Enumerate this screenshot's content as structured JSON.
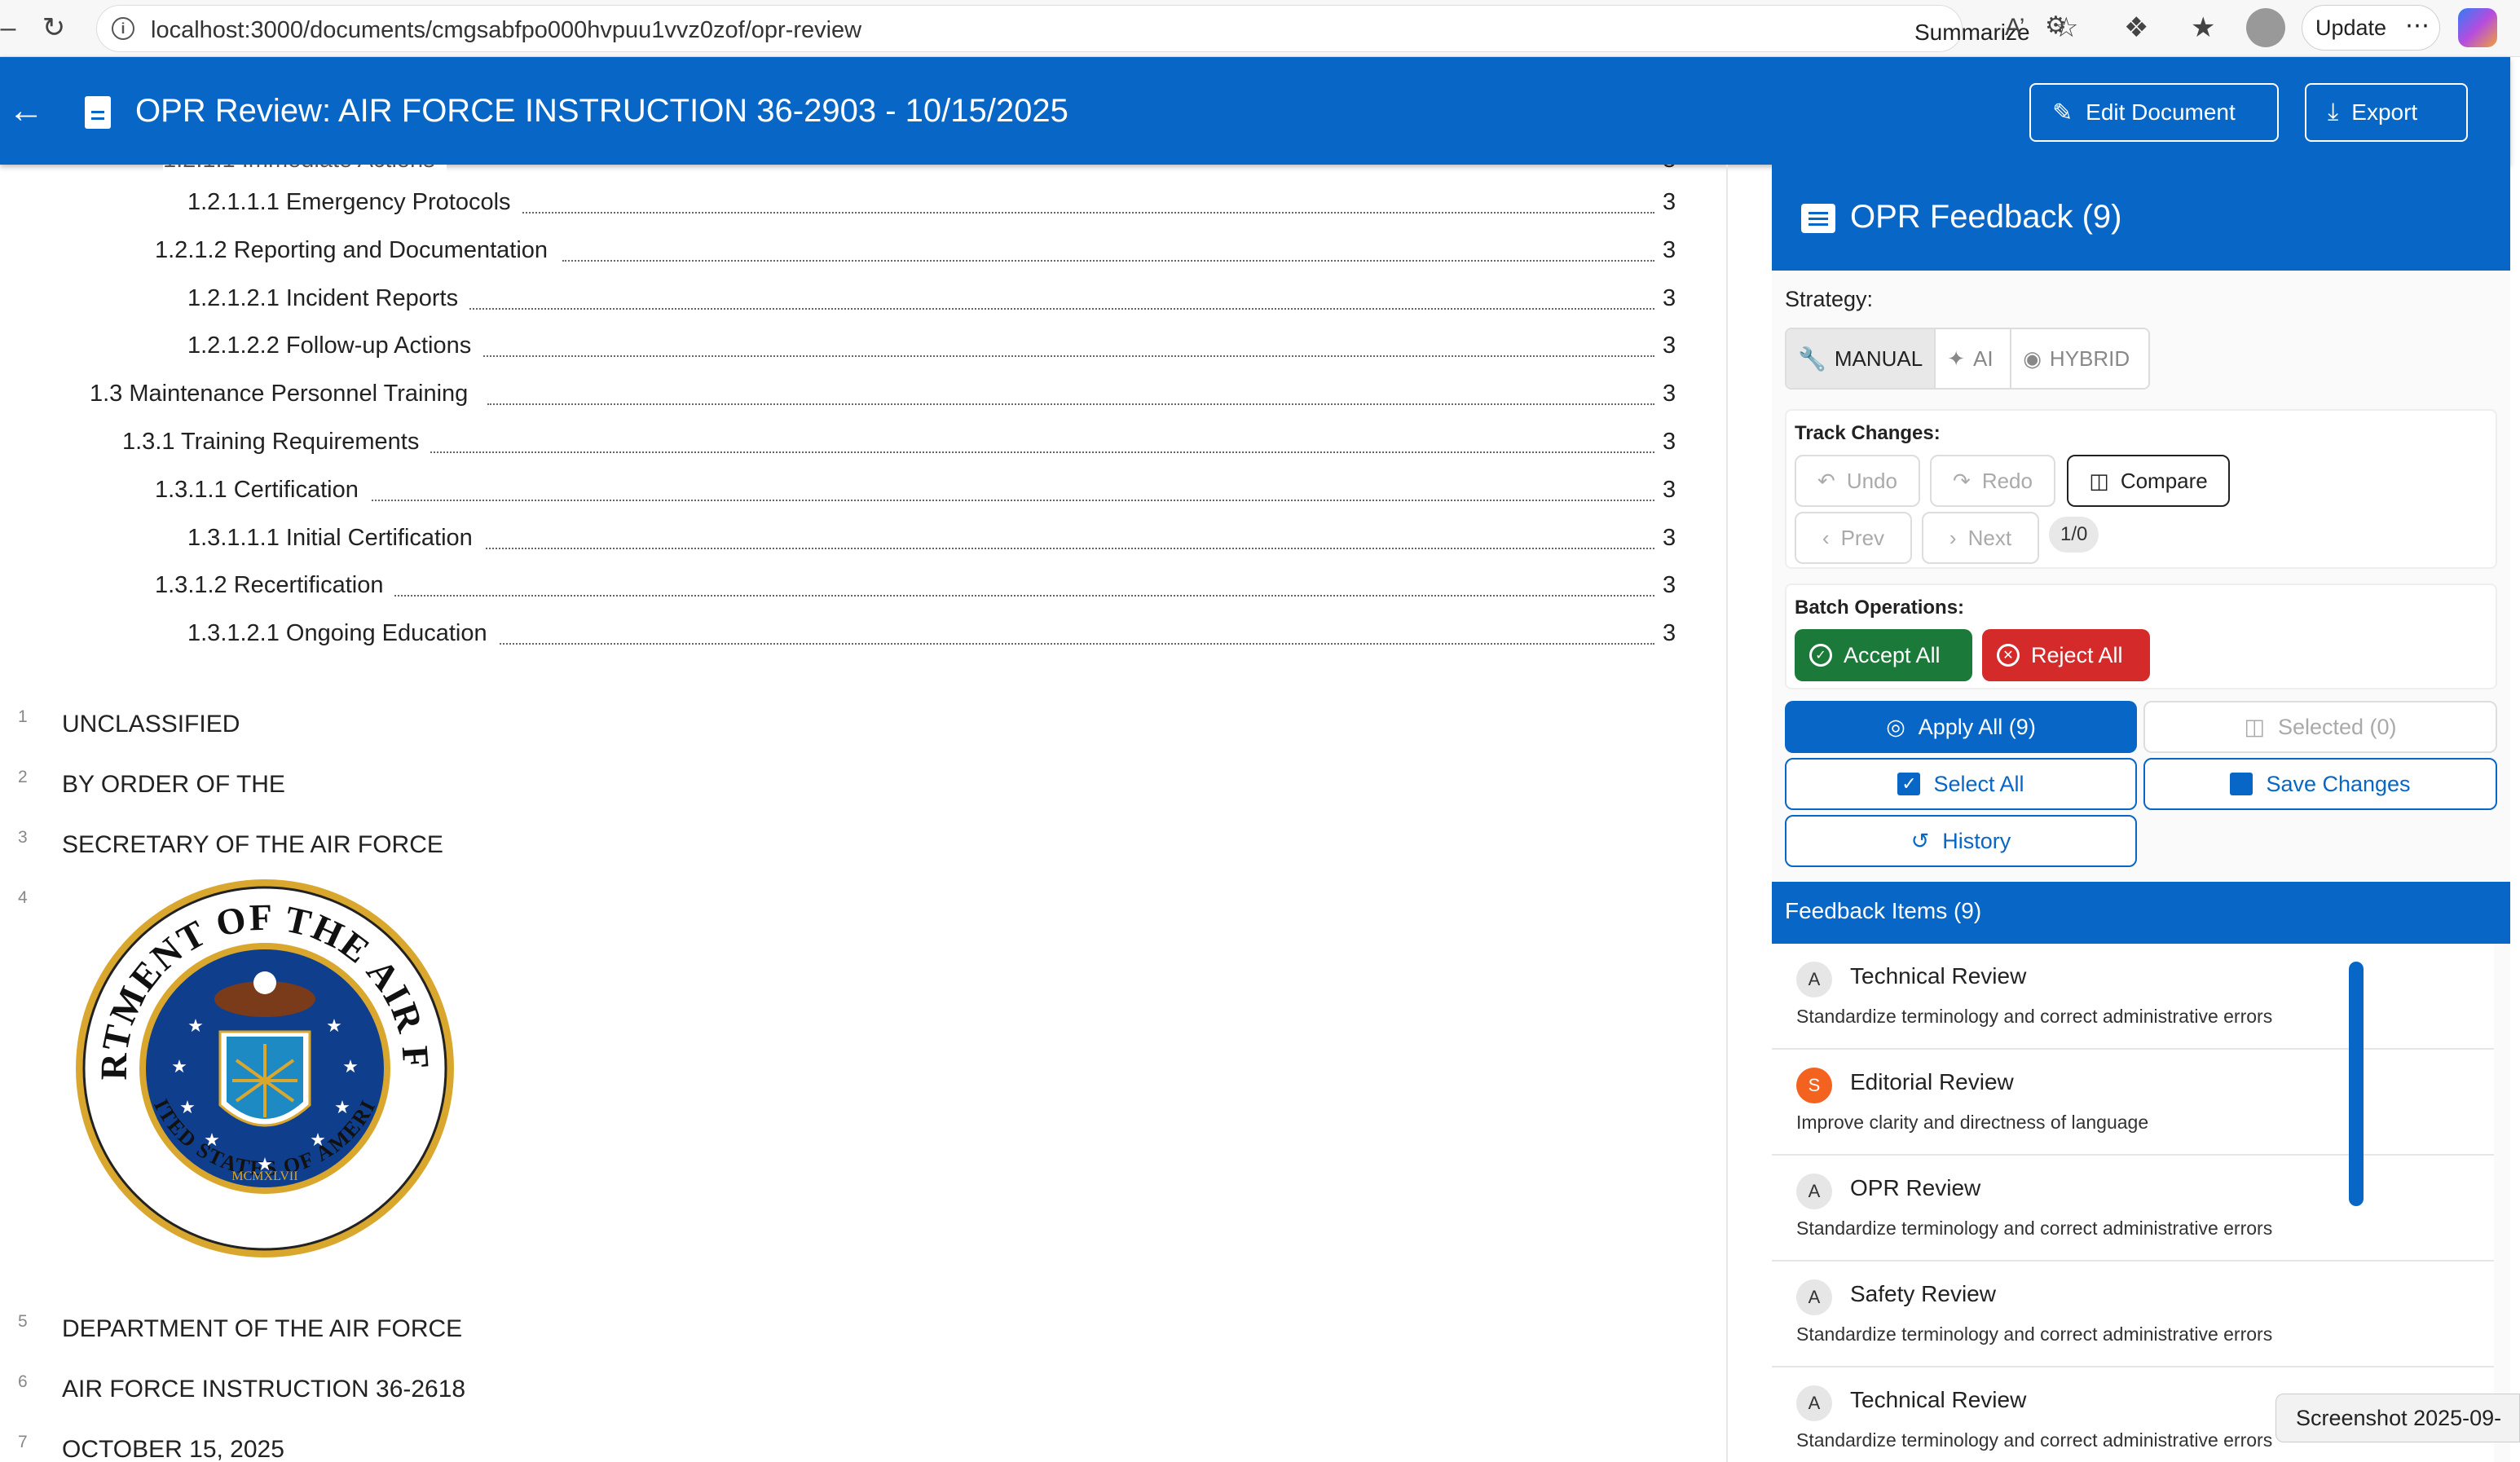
{
  "browser": {
    "url": "localhost:3000/documents/cmgsabfpo000hvpuu1vvz0zof/opr-review",
    "summarize_label": "Summarize",
    "update_label": "Update"
  },
  "header": {
    "title": "OPR Review: AIR FORCE INSTRUCTION 36-2903 - 10/15/2025",
    "edit_label": "Edit Document",
    "export_label": "Export"
  },
  "document": {
    "toc": [
      {
        "text": "1.2.1.1.1 Emergency Protocols",
        "page": "3"
      },
      {
        "text": "1.2.1.2 Reporting and Documentation",
        "page": "3"
      },
      {
        "text": "1.2.1.2.1 Incident Reports",
        "page": "3"
      },
      {
        "text": "1.2.1.2.2 Follow-up Actions",
        "page": "3"
      },
      {
        "text": "1.3 Maintenance Personnel Training",
        "page": "3"
      },
      {
        "text": "1.3.1 Training Requirements",
        "page": "3"
      },
      {
        "text": "1.3.1.1 Certification",
        "page": "3"
      },
      {
        "text": "1.3.1.1.1 Initial Certification",
        "page": "3"
      },
      {
        "text": "1.3.1.2 Recertification",
        "page": "3"
      },
      {
        "text": "1.3.1.2.1 Ongoing Education",
        "page": "3"
      }
    ],
    "lines": [
      {
        "no": "1",
        "text": "UNCLASSIFIED"
      },
      {
        "no": "2",
        "text": "BY ORDER OF THE"
      },
      {
        "no": "3",
        "text": "SECRETARY OF THE AIR FORCE"
      },
      {
        "no": "4",
        "text": ""
      },
      {
        "no": "5",
        "text": "DEPARTMENT OF THE AIR FORCE"
      },
      {
        "no": "6",
        "text": "AIR FORCE INSTRUCTION 36-2618"
      },
      {
        "no": "7",
        "text": "OCTOBER 15, 2025"
      }
    ],
    "seal": {
      "top_text": "DEPARTMENT OF THE AIR FORCE",
      "bottom_text": "UNITED STATES OF AMERICA",
      "year": "MCMXLVII"
    }
  },
  "panel": {
    "title": "OPR Feedback (9)",
    "strategy_label": "Strategy:",
    "strategies": [
      "MANUAL",
      "AI",
      "HYBRID"
    ],
    "track_changes_label": "Track Changes:",
    "undo": "Undo",
    "redo": "Redo",
    "compare": "Compare",
    "prev": "Prev",
    "next": "Next",
    "counter": "1/0",
    "batch_label": "Batch Operations:",
    "accept_all": "Accept All",
    "reject_all": "Reject All",
    "apply_all": "Apply All (9)",
    "selected": "Selected (0)",
    "select_all": "Select All",
    "save_changes": "Save Changes",
    "history": "History",
    "items_title": "Feedback Items (9)",
    "items": [
      {
        "avatar": "A",
        "name": "Technical Review",
        "desc": "Standardize terminology and correct administrative errors"
      },
      {
        "avatar": "S",
        "name": "Editorial Review",
        "desc": "Improve clarity and directness of language"
      },
      {
        "avatar": "A",
        "name": "OPR Review",
        "desc": "Standardize terminology and correct administrative errors"
      },
      {
        "avatar": "A",
        "name": "Safety Review",
        "desc": "Standardize terminology and correct administrative errors"
      },
      {
        "avatar": "A",
        "name": "Technical Review",
        "desc": "Standardize terminology and correct administrative errors"
      }
    ]
  },
  "toast": "Screenshot 2025-09-",
  "colors": {
    "primary": "#0866c6",
    "accept": "#1b7a3a",
    "reject": "#d42a2a",
    "avatar_orange": "#f4621f"
  }
}
